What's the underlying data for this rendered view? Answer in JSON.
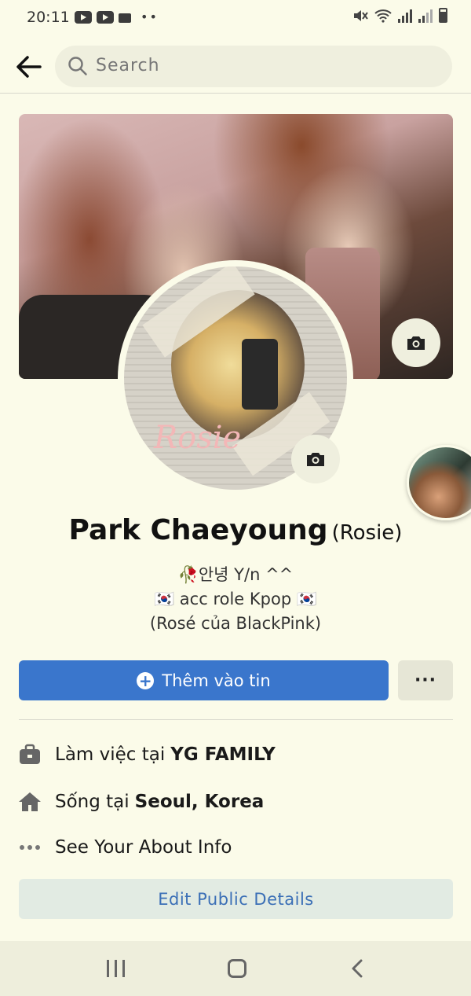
{
  "status_bar": {
    "time": "20:11"
  },
  "search": {
    "placeholder": "Search"
  },
  "profile": {
    "name": "Park Chaeyoung",
    "nickname": "(Rosie)",
    "avatar_caption": "Rosie",
    "bio_lines": [
      "🥀안녕 Y/n ^^",
      "🇰🇷 acc role Kpop 🇰🇷",
      "(Rosé của BlackPink)"
    ]
  },
  "actions": {
    "add_story_label": "Thêm vào tin",
    "more_label": "···"
  },
  "details": {
    "work_prefix": "Làm việc tại",
    "work_place": "YG FAMILY",
    "live_prefix": "Sống tại",
    "live_place": "Seoul, Korea",
    "about_label": "See Your About Info",
    "edit_label": "Edit Public Details"
  },
  "colors": {
    "background": "#fbfbe9",
    "accent": "#3a76cc",
    "edit_text": "#3b6fb6"
  },
  "icons": [
    "back-arrow-icon",
    "search-icon",
    "camera-icon",
    "plus-circle-icon",
    "briefcase-icon",
    "home-icon",
    "more-dots-icon"
  ]
}
